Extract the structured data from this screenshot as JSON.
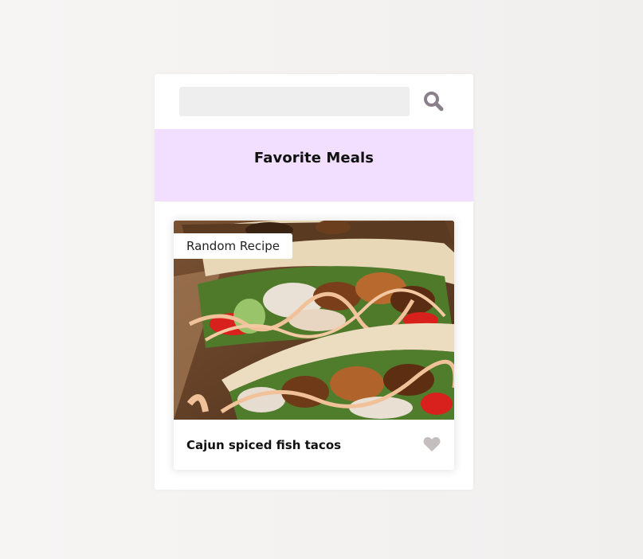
{
  "search": {
    "value": "",
    "placeholder": ""
  },
  "icons": {
    "search": "search-icon",
    "heart": "heart-icon"
  },
  "favorites": {
    "title": "Favorite Meals"
  },
  "meal": {
    "badge": "Random Recipe",
    "title": "Cajun spiced fish tacos",
    "image_alt": "Cajun spiced fish tacos"
  },
  "colors": {
    "fav_band": "#f2defe",
    "search_icon": "#8a7f8a",
    "heart_icon": "#c4bebe"
  }
}
